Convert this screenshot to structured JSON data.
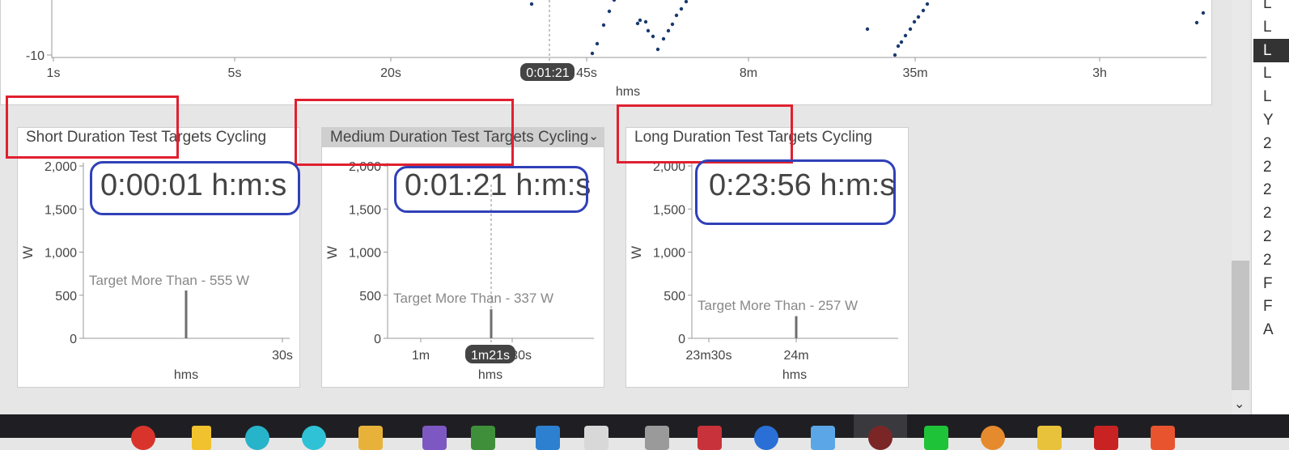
{
  "top_chart": {
    "y_tick": "-10",
    "x_ticks": [
      "1s",
      "5s",
      "20s",
      "45s",
      "8m",
      "35m",
      "3h"
    ],
    "x_label": "hms",
    "cursor_label": "0:01:21"
  },
  "cards": [
    {
      "title": "Short Duration Test Targets Cycling",
      "readout": "0:00:01 h:m:s",
      "target_text": "Target More Than - 555 W",
      "y_label": "W",
      "y_ticks": [
        "2,000",
        "1,500",
        "1,000",
        "500",
        "0"
      ],
      "x_ticks": [
        "30s"
      ],
      "x_label": "hms",
      "bar_value": 555
    },
    {
      "title": "Medium Duration Test Targets Cycling",
      "readout": "0:01:21 h:m:s",
      "target_text": "Target More Than - 337 W",
      "y_label": "W",
      "y_ticks": [
        "2,000",
        "1,500",
        "1,000",
        "500",
        "0"
      ],
      "x_ticks": [
        "1m",
        "1m30s"
      ],
      "x_label": "hms",
      "cursor_label": "1m21s",
      "bar_value": 337
    },
    {
      "title": "Long Duration Test Targets Cycling",
      "readout": "0:23:56 h:m:s",
      "target_text": "Target More Than - 257 W",
      "y_label": "W",
      "y_ticks": [
        "2,000",
        "1,500",
        "1,000",
        "500",
        "0"
      ],
      "x_ticks": [
        "23m30s",
        "24m"
      ],
      "x_label": "hms",
      "bar_value": 257
    }
  ],
  "sidebar_letters": [
    "L",
    "L",
    "L",
    "L",
    "L",
    "Y",
    "2",
    "2",
    "2",
    "2",
    "2",
    "2",
    "F",
    "F",
    "A"
  ],
  "sidebar_selected_index": 2,
  "icons": {
    "dropdown": "chevron-down-icon",
    "scroll_down": "scroll-down-arrow-icon"
  },
  "colors": {
    "annotation_red": "#e02030",
    "annotation_blue": "#3040b8",
    "scatter_points": "#1a3a6e",
    "bar": "#6e6e6e"
  }
}
